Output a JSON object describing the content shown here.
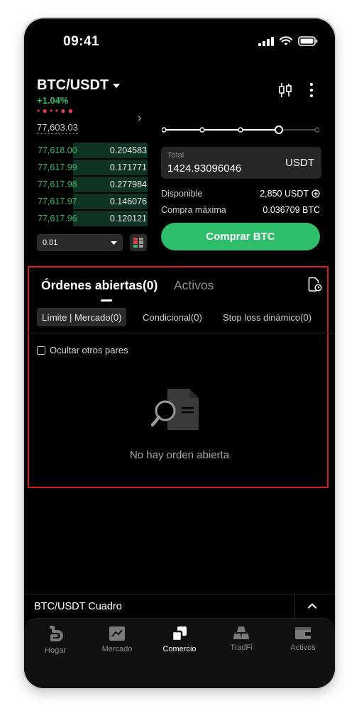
{
  "status_bar": {
    "time": "09:41"
  },
  "header": {
    "pair": "BTC/USDT",
    "change": "+1.04%"
  },
  "orderbook": {
    "mid_price": "77,603.03",
    "bids": [
      {
        "price": "77,618.00",
        "qty": "0.204583",
        "depth": 0.19
      },
      {
        "price": "77,617.99",
        "qty": "0.171771",
        "depth": 0.19
      },
      {
        "price": "77,617.98",
        "qty": "0.277984",
        "depth": 0.19
      },
      {
        "price": "77,617.97",
        "qty": "0.146076",
        "depth": 0.19
      },
      {
        "price": "77,617.96",
        "qty": "0.120121",
        "depth": 0.19
      }
    ],
    "depth_value": "0.01"
  },
  "trade": {
    "slider_value": 0.75,
    "total_label": "Total",
    "total_value": "1424.93096046",
    "total_unit": "USDT",
    "available_label": "Disponible",
    "available_value": "2,850 USDT",
    "max_buy_label": "Compra máxima",
    "max_buy_value": "0.036709 BTC",
    "buy_button": "Comprar BTC"
  },
  "orders": {
    "tab_open": "Órdenes abiertas(0)",
    "tab_assets": "Activos",
    "subtabs": [
      "Límite | Mercado(0)",
      "Condicional(0)",
      "Stop loss dinámico(0)"
    ],
    "hide_other_pairs": "Ocultar otros pares",
    "empty_message": "No hay orden abierta"
  },
  "chart_bar": {
    "title": "BTC/USDT Cuadro"
  },
  "nav": {
    "items": [
      {
        "label": "Hogar",
        "icon": "home-icon"
      },
      {
        "label": "Mercado",
        "icon": "market-chart-icon"
      },
      {
        "label": "Comercio",
        "icon": "trade-icon"
      },
      {
        "label": "TradFi",
        "icon": "tradfi-gold-icon"
      },
      {
        "label": "Activos",
        "icon": "wallet-icon"
      }
    ],
    "active": "Comercio"
  },
  "colors": {
    "accent_green": "#2ebd6b",
    "highlight_red": "#d21f1f",
    "background": "#000000"
  }
}
